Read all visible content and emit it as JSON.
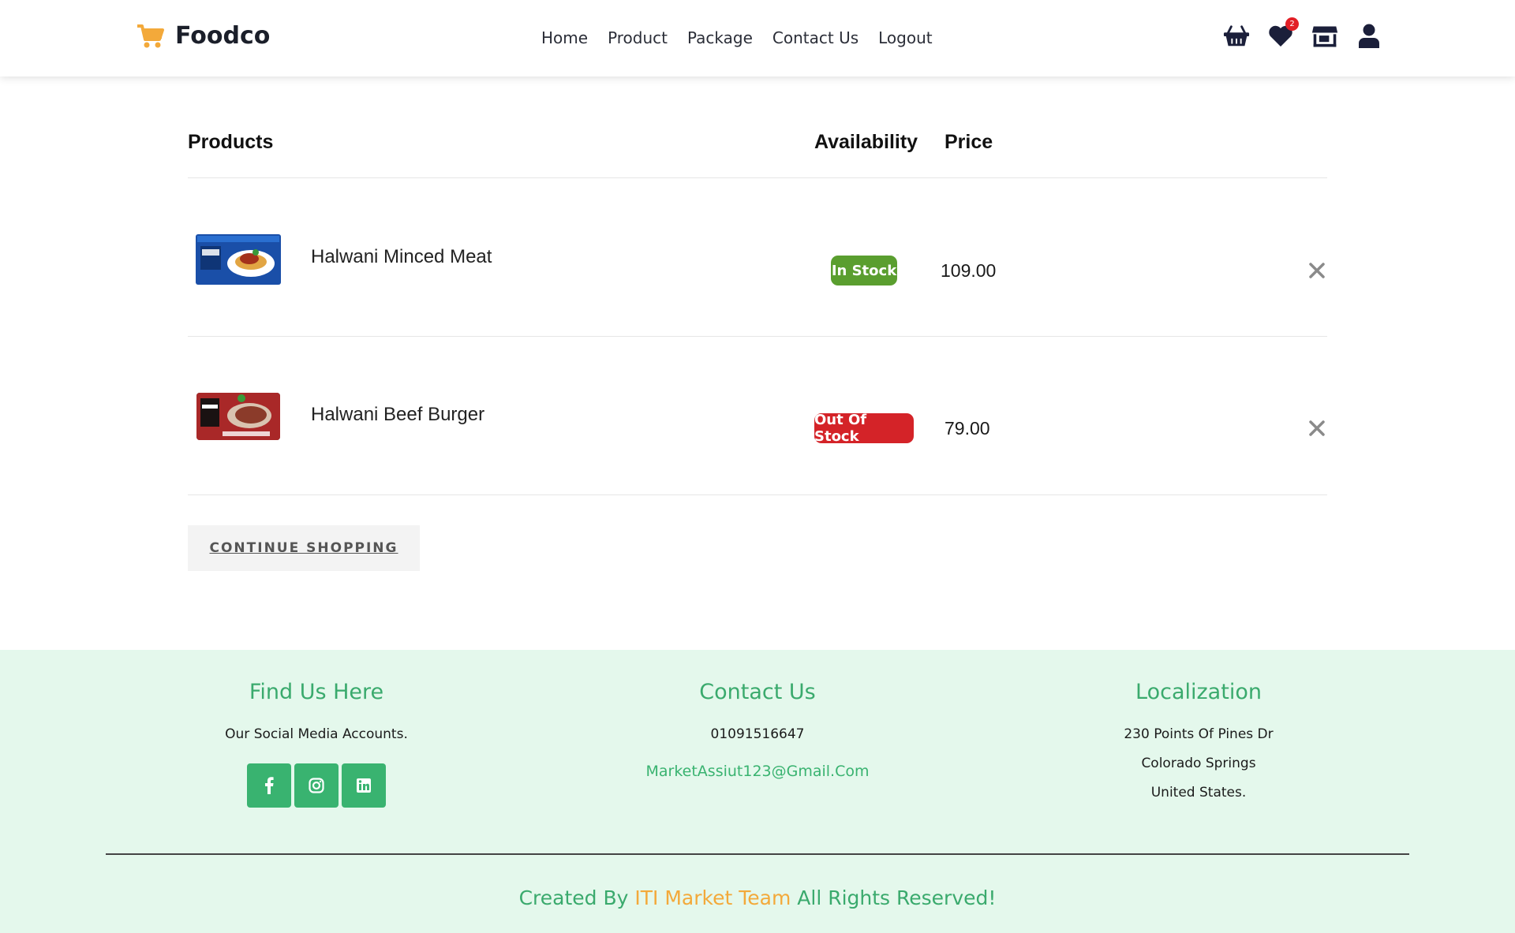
{
  "brand": {
    "name": "Foodco"
  },
  "nav": [
    "Home",
    "Product",
    "Package",
    "Contact Us",
    "Logout"
  ],
  "header_icons": {
    "wishlist_count": "2"
  },
  "table": {
    "headers": {
      "products": "Products",
      "availability": "Availability",
      "price": "Price"
    },
    "rows": [
      {
        "name": "Halwani Minced Meat",
        "status": "In Stock",
        "status_color": "#5a9e2f",
        "price": "109.00"
      },
      {
        "name": "Halwani Beef Burger",
        "status": "Out Of Stock",
        "status_color": "#d42328",
        "price": "79.00"
      }
    ]
  },
  "continue_label": "CONTINUE SHOPPING",
  "footer": {
    "find_us": {
      "title": "Find Us Here",
      "text": "Our Social Media Accounts."
    },
    "contact": {
      "title": "Contact Us",
      "phone": "01091516647",
      "email": "MarketAssiut123@Gmail.Com"
    },
    "localization": {
      "title": "Localization",
      "line1": "230 Points Of Pines Dr",
      "line2": "Colorado Springs",
      "line3": "United States."
    },
    "credit": {
      "prefix": "Created By",
      "team": "ITI Market Team",
      "suffix": "All Rights Reserved!"
    }
  },
  "colors": {
    "accent_green": "#3aaa6d",
    "accent_orange": "#f3a93a",
    "footer_bg": "#e4f8ec"
  }
}
